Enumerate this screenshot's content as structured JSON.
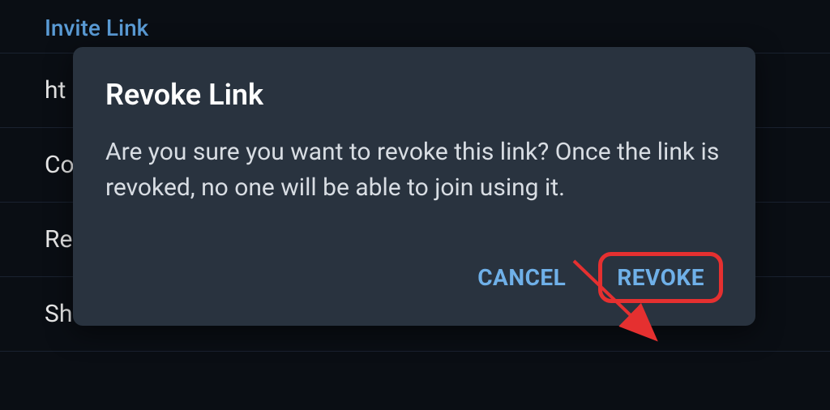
{
  "background": {
    "section_header": "Invite Link",
    "items": [
      "ht",
      "Co",
      "Re",
      "Sh"
    ]
  },
  "modal": {
    "title": "Revoke Link",
    "body": "Are you sure you want to revoke this link? Once the link is revoked, no one will be able to join using it.",
    "cancel_label": "CANCEL",
    "revoke_label": "REVOKE"
  },
  "colors": {
    "accent": "#6fb0e8",
    "danger_highlight": "#e53030",
    "modal_bg": "#29333f",
    "page_bg": "#0a0e14"
  }
}
